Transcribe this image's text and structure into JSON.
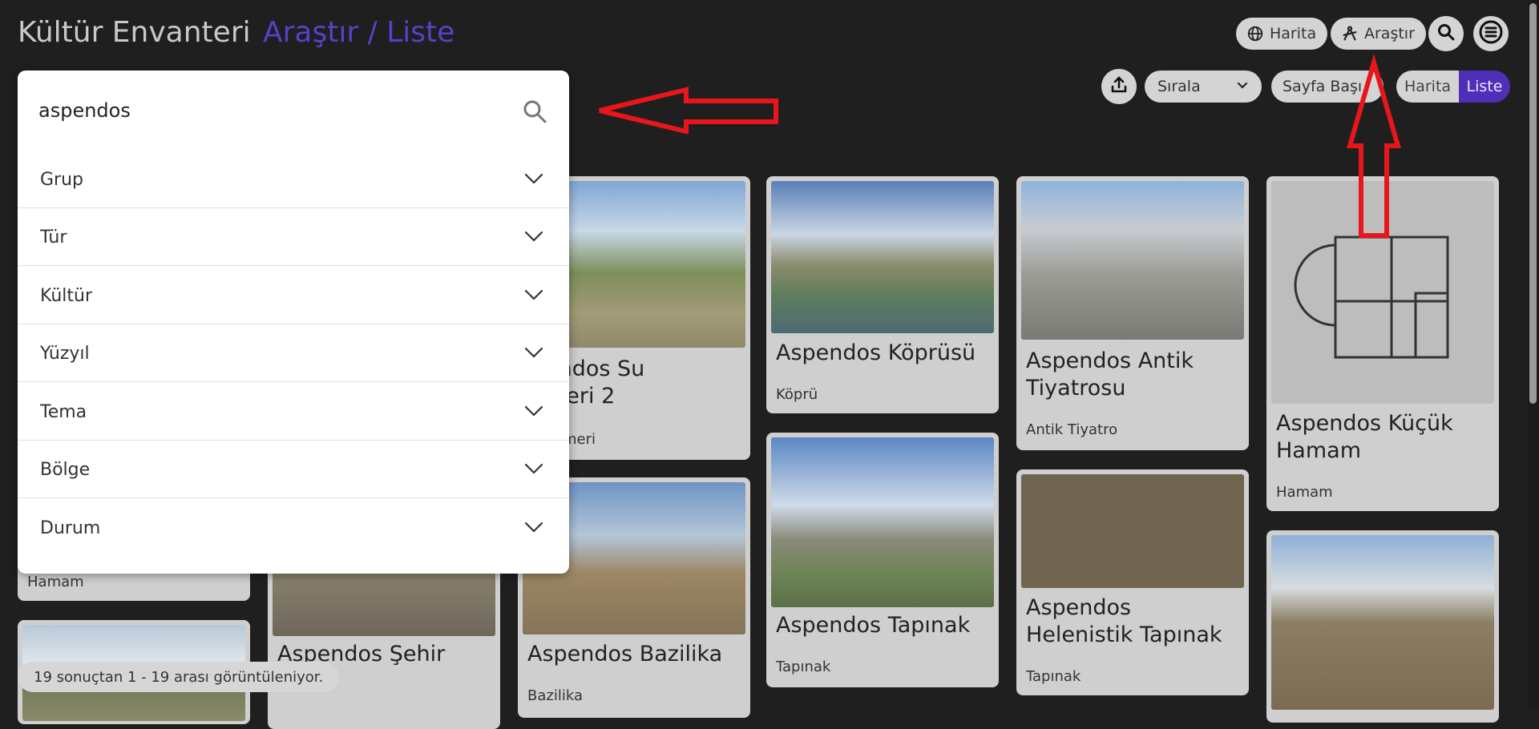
{
  "header": {
    "app_title": "Kültür Envanteri",
    "breadcrumb": "Araştır / Liste",
    "map_button": "Harita",
    "explore_button": "Araştır"
  },
  "toolbar": {
    "sort_label": "Sırala",
    "page_size_label": "Sayfa Başı",
    "view_map": "Harita",
    "view_list": "Liste",
    "active_view": "Liste"
  },
  "search": {
    "value": "aspendos",
    "filters": [
      "Grup",
      "Tür",
      "Kültür",
      "Yüzyıl",
      "Tema",
      "Bölge",
      "Durum"
    ]
  },
  "cards": [
    {
      "title": "Aspendos Su Kemeri 2",
      "visible_title": "endos Su\nmeri 2",
      "type": "meri"
    },
    {
      "title": "Aspendos Köprüsü",
      "type": "Köprü"
    },
    {
      "title": "Aspendos Antik Tiyatrosu",
      "type": "Antik Tiyatro"
    },
    {
      "title": "Aspendos Küçük Hamam",
      "type": "Hamam"
    },
    {
      "title": "",
      "type": "Hamam"
    },
    {
      "title": "Aspendos Şehir",
      "type": ""
    },
    {
      "title": "Aspendos Bazilika",
      "type": "Bazilika"
    },
    {
      "title": "Aspendos Tapınak",
      "type": "Tapınak"
    },
    {
      "title": "Aspendos Helenistik Tapınak",
      "type": "Tapınak"
    }
  ],
  "status": "19 sonuçtan 1 - 19 arası görüntüleniyor.",
  "colors": {
    "accent": "#4f2fb8",
    "annotation": "#e8161b",
    "background": "#1f1f1f"
  }
}
